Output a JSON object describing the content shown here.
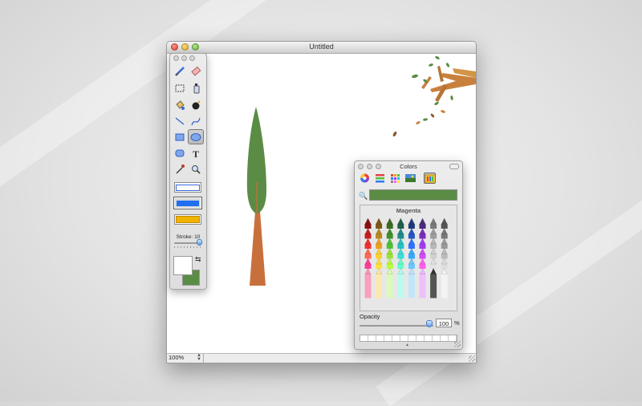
{
  "window": {
    "title": "Untitled",
    "zoom": "100%"
  },
  "tools": {
    "items": [
      "paintbrush",
      "eraser",
      "rectangular-select",
      "spray-can",
      "paint-bucket",
      "bomb",
      "line",
      "curve",
      "rectangle",
      "ellipse",
      "rounded-rectangle",
      "text",
      "eyedropper",
      "magnifier"
    ],
    "selected": "ellipse",
    "stroke_label": "Stroke: 10",
    "stroke_value": 10,
    "stroke_color": "#ffffff",
    "fill_color": "#5b8c45"
  },
  "colors_panel": {
    "title": "Colors",
    "modes": [
      "color-wheel",
      "color-sliders",
      "color-palettes",
      "image-palettes",
      "crayons"
    ],
    "active_mode": "crayons",
    "current_color": "#5b8c45",
    "crayon_name": "Magenta",
    "opacity_label": "Opacity",
    "opacity_value": "100",
    "opacity_unit": "%",
    "crayon_colors": [
      [
        "#8b0f0f",
        "#7b5a16",
        "#3c6b22",
        "#1e5f4a",
        "#1e3a7a",
        "#4a2a7a",
        "#7a7a7a",
        "#555555"
      ],
      [
        "#c81d1d",
        "#b8871e",
        "#3f8f2c",
        "#1f8b8b",
        "#2456c8",
        "#7a2fb8",
        "#9c9c9c",
        "#777777"
      ],
      [
        "#f03030",
        "#f0a020",
        "#4fc235",
        "#22c2c0",
        "#2f73ff",
        "#a23cf0",
        "#b8b8b8",
        "#999999"
      ],
      [
        "#ff6a50",
        "#ffd030",
        "#9ae23a",
        "#3ae0d8",
        "#37a8ff",
        "#d04cf5",
        "#d0d0d0",
        "#bbbbbb"
      ],
      [
        "#ff3d9a",
        "#ffe040",
        "#b7ff3a",
        "#63ffc8",
        "#6cc8ff",
        "#ff60e8",
        "#e2e2e2",
        "#dddddd"
      ],
      [
        "#ff8fb0",
        "#ffe8a0",
        "#d8ffb0",
        "#b0fff0",
        "#b8e6ff",
        "#f0b6ff",
        "#303030",
        "#f6f6f6"
      ]
    ]
  }
}
